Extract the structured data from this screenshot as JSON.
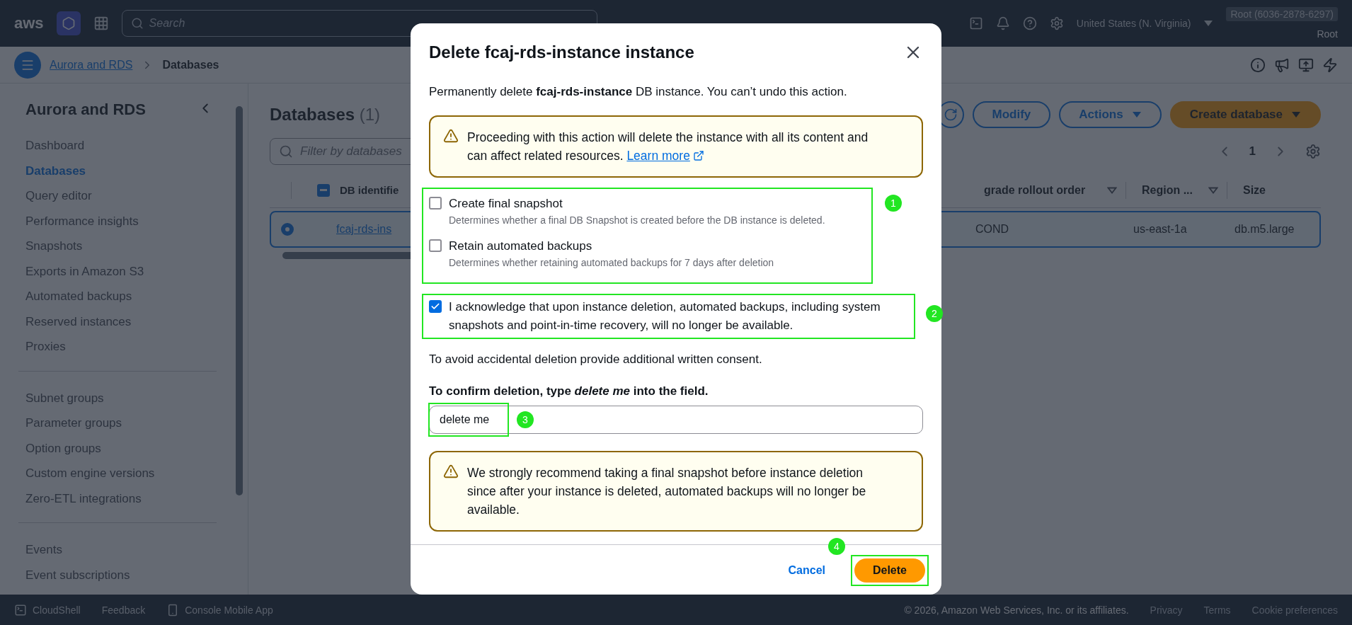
{
  "top_nav": {
    "logo": "aws",
    "search": {
      "placeholder": "Search"
    },
    "region": "United States (N. Virginia)",
    "account": "Root (6036-2878-6297)",
    "user": "Root"
  },
  "breadcrumbs": [
    {
      "label": "Aurora and RDS",
      "link": true
    },
    {
      "label": "Databases",
      "link": false
    }
  ],
  "sidebar": {
    "title": "Aurora and RDS",
    "groups": [
      [
        {
          "label": "Dashboard",
          "selected": false
        },
        {
          "label": "Databases",
          "selected": true
        },
        {
          "label": "Query editor",
          "selected": false
        },
        {
          "label": "Performance insights",
          "selected": false
        },
        {
          "label": "Snapshots",
          "selected": false
        },
        {
          "label": "Exports in Amazon S3",
          "selected": false
        },
        {
          "label": "Automated backups",
          "selected": false
        },
        {
          "label": "Reserved instances",
          "selected": false
        },
        {
          "label": "Proxies",
          "selected": false
        }
      ],
      [
        {
          "label": "Subnet groups",
          "selected": false
        },
        {
          "label": "Parameter groups",
          "selected": false
        },
        {
          "label": "Option groups",
          "selected": false
        },
        {
          "label": "Custom engine versions",
          "selected": false
        },
        {
          "label": "Zero-ETL integrations",
          "selected": false
        }
      ],
      [
        {
          "label": "Events",
          "selected": false
        },
        {
          "label": "Event subscriptions",
          "selected": false
        }
      ]
    ]
  },
  "main": {
    "title": "Databases",
    "count": "(1)",
    "buttons": [
      {
        "label": "Modify",
        "kind": "outline"
      },
      {
        "label": "Actions",
        "kind": "dropdown"
      },
      {
        "label": "Create database",
        "kind": "primary"
      }
    ],
    "filter": {
      "placeholder": "Filter by databases"
    },
    "page": "1",
    "table": {
      "select_all_indeterminate": true,
      "column_left": "DB identifie",
      "columns_right": [
        "grade rollout order",
        "Region ...",
        "Size"
      ],
      "rows": [
        {
          "selected": true,
          "cell_left": "fcaj-rds-ins",
          "cells_right": [
            "COND",
            "us-east-1a",
            "db.m5.large"
          ]
        }
      ]
    }
  },
  "modal": {
    "title": "Delete fcaj-rds-instance instance",
    "intro": "Permanently delete **fcaj-rds-instance** DB instance. You can’t undo this action.",
    "alert": {
      "text": "Proceeding with this action will delete the instance with all its content and can affect related resources.",
      "link": "Learn more"
    },
    "options": [
      {
        "label": "Create final snapshot",
        "description": "Determines whether a final DB Snapshot is created before the DB instance is deleted.",
        "checked": false
      },
      {
        "label": "Retain automated backups",
        "description": "Determines whether retaining automated backups for 7 days after deletion",
        "checked": false
      }
    ],
    "acknowledge": {
      "label": "I acknowledge that upon instance deletion, automated backups, including system snapshots and point-in-time recovery, will no longer be available.",
      "checked": true
    },
    "consent_note": "To avoid accidental deletion provide additional written consent.",
    "confirm_label": "To confirm deletion, type *delete me* into the field.",
    "confirm_value": "delete me",
    "warning": "We strongly recommend taking a final snapshot before instance deletion since after your instance is deleted, automated backups will no longer be available.",
    "cancel": "Cancel",
    "delete": "Delete"
  },
  "annotations": [
    {
      "label": "1"
    },
    {
      "label": "2"
    },
    {
      "label": "3"
    },
    {
      "label": "4"
    }
  ],
  "footer": {
    "items": [
      "CloudShell",
      "Feedback",
      "Console Mobile App"
    ],
    "copyright": "© 2026, Amazon Web Services, Inc. or its affiliates.",
    "links": [
      "Privacy",
      "Terms",
      "Cookie preferences"
    ]
  }
}
